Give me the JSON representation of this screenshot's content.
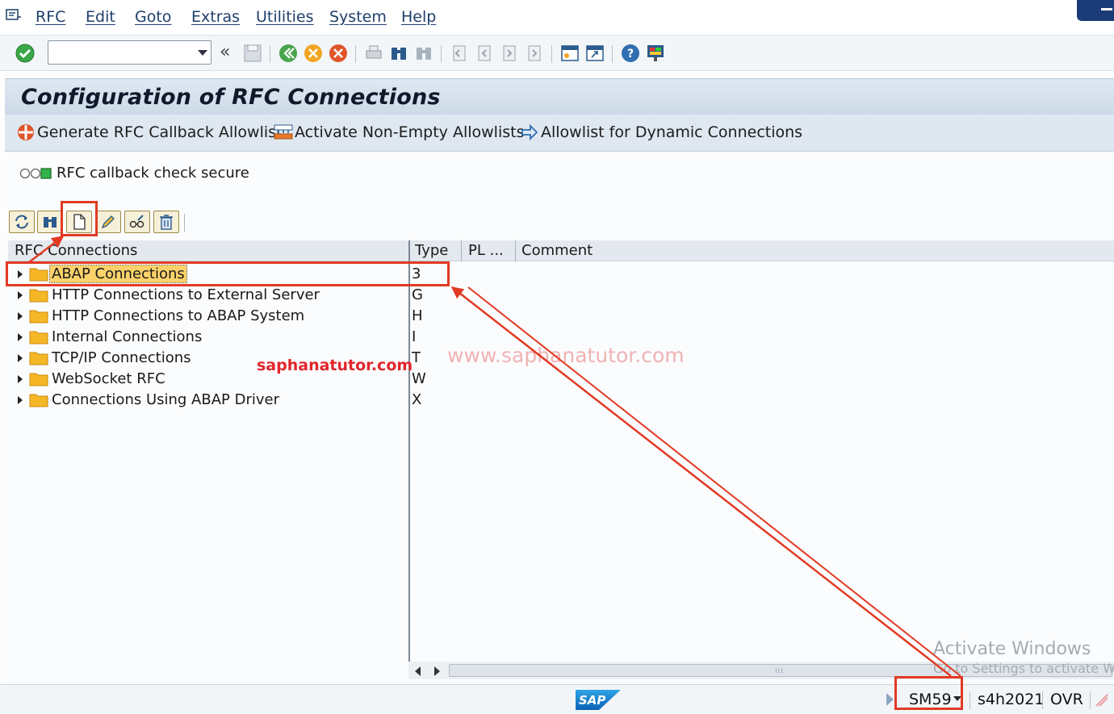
{
  "menu": {
    "items": [
      "RFC",
      "Edit",
      "Goto",
      "Extras",
      "Utilities",
      "System",
      "Help"
    ]
  },
  "toolbar": {
    "command_value": "",
    "back_label": "«"
  },
  "title": "Configuration of RFC Connections",
  "app_toolbar": {
    "generate_label": "Generate RFC Callback Allowlist",
    "activate_label": "Activate Non-Empty Allowlists",
    "dynamic_label": "Allowlist for Dynamic Connections"
  },
  "status_text": "RFC callback check secure",
  "tree": {
    "columns": [
      "RFC Connections",
      "Type",
      "PL ...",
      "Comment"
    ],
    "rows": [
      {
        "name": "ABAP Connections",
        "type": "3"
      },
      {
        "name": "HTTP Connections to External Server",
        "type": "G"
      },
      {
        "name": "HTTP Connections to ABAP System",
        "type": "H"
      },
      {
        "name": "Internal Connections",
        "type": "I"
      },
      {
        "name": "TCP/IP Connections",
        "type": "T"
      },
      {
        "name": "WebSocket RFC",
        "type": "W"
      },
      {
        "name": "Connections Using ABAP Driver",
        "type": "X"
      }
    ]
  },
  "watermarks": {
    "strong": "saphanatutor.com",
    "light": "www.saphanatutor.com"
  },
  "windows_notice": {
    "line1": "Activate Windows",
    "line2": "Go to Settings to activate Wi"
  },
  "statusbar": {
    "transaction": "SM59",
    "system": "s4h2021",
    "mode": "OVR"
  },
  "colors": {
    "highlight": "#e23a23",
    "selected_row": "#fbd26a",
    "title_band": "#cddae8"
  }
}
